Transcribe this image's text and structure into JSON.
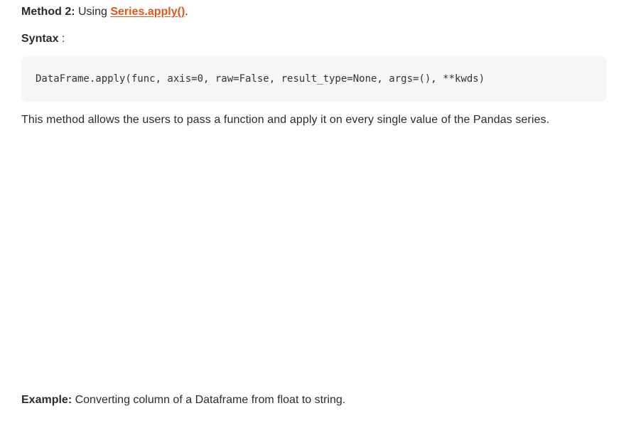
{
  "method": {
    "label": "Method 2:",
    "text": " Using ",
    "link_text": "Series.apply()",
    "suffix": "."
  },
  "syntax": {
    "label": "Syntax",
    "suffix": " :"
  },
  "code": {
    "text": "DataFrame.apply(func, axis=0, raw=False, result_type=None, args=(), **kwds)"
  },
  "description": {
    "text": "This method allows the users to pass a function and apply it on every single value of the Pandas series."
  },
  "example": {
    "label": "Example:",
    "text": " Converting column of a Dataframe from float to string."
  },
  "colors": {
    "link": "#e1561e",
    "code_background": "#f6f6f6",
    "text": "#2b2b2b"
  }
}
